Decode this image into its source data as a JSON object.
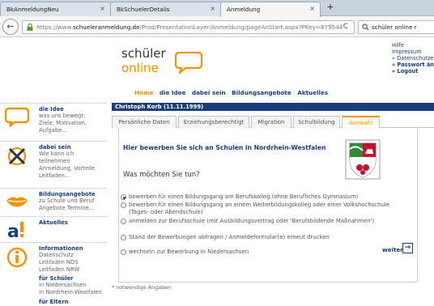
{
  "browser": {
    "tabs": [
      {
        "title": "BkAnmeldungNeu",
        "active": false
      },
      {
        "title": "BkSchuelerDetails",
        "active": false
      },
      {
        "title": "Anmeldung",
        "active": true
      }
    ],
    "close_glyph": "×",
    "new_tab_glyph": "+",
    "url_prefix": "https://www.",
    "url_domain": "schueleranmeldung.de",
    "url_path": "/Prod/PresentationLayer/Anmeldung/pageAnStart.aspx?PKey=875544",
    "search_text": "schüler online r",
    "back_glyph": "←",
    "dropdown_glyph": "▽",
    "reload_glyph": "C",
    "search_glyph": "🔍"
  },
  "header": {
    "logo_line1": "schüler",
    "logo_line2": "online",
    "top_links": [
      {
        "text": "Hilfe",
        "bold": false
      },
      {
        "text": "Impressum",
        "bold": false
      },
      {
        "text": "» Datenschutzerklä",
        "bold": false
      },
      {
        "text": "« Passwort änder",
        "bold": true
      },
      {
        "text": "« Logout",
        "bold": true
      }
    ],
    "nav": [
      "Home",
      "die Idee",
      "dabei sein",
      "Bildungsangebote",
      "Aktuelles"
    ]
  },
  "sidebar": {
    "items": [
      {
        "title": "die Idee",
        "desc": [
          "was uns bewegt:",
          "Ziele, Motivation,",
          "Aufgabe..."
        ],
        "icon": "speech-bubble-icon"
      },
      {
        "title": "dabei sein",
        "desc": [
          "Wie kann ich",
          "teilnehmen",
          "Anmeldung, Vorteile",
          "Leitfaden..."
        ],
        "icon": "cross-circle-icon"
      },
      {
        "title": "Bildungsangebote",
        "desc": [
          "zu Schule und Beruf",
          "Angebote Termine..."
        ],
        "icon": "lips-icon"
      },
      {
        "title": "Aktuelles",
        "desc": [],
        "icon": "a-exclaim-icon"
      },
      {
        "title": "Informationen",
        "desc": [
          "Datenschutz",
          "Leitfaden NDS",
          "Leitfaden NRW"
        ],
        "icon": "info-icon"
      }
    ],
    "extra": [
      {
        "title": "für Schüler",
        "desc": [
          "in Niedersachsen",
          "in Nordrhein-Westfalen"
        ]
      },
      {
        "title": "für Eltern",
        "desc": []
      }
    ],
    "colors": {
      "orange": "#f39200",
      "navy": "#1a3d7c"
    }
  },
  "form": {
    "student_name": "Christoph Korb (11.11.1999)",
    "tabs": [
      "Persönliche Daten",
      "Erziehungsberechtigt",
      "Migration",
      "Schulbildung",
      "Auswahl"
    ],
    "active_tab": "Auswahl",
    "heading": "Hier bewerben Sie sich an Schulen in Nordrhein-Westfalen",
    "question": "Was möchten Sie tun?",
    "options": [
      {
        "lines": [
          "bewerben für einen Bildungsgang am Berufskolleg (ohne Berufliches Gymnasium)"
        ],
        "selected": true
      },
      {
        "lines": [
          "bewerben für einen Bildungsgang an einem Weiterbildungskolleg oder einer Volkshochschule",
          "(Tages- oder Abendschule)"
        ],
        "selected": false
      },
      {
        "lines": [
          "anmelden zur Berufsschule (mit Ausbildungsvertrag oder 'Berufsbildende Maßnahmen')"
        ],
        "selected": false
      },
      {
        "lines": [
          "Stand der Bewerbungen abfragen / Anmeldeformular(e) erneut drucken"
        ],
        "selected": false
      },
      {
        "lines": [
          "wechseln zur Bewerbung in Niedersachsen"
        ],
        "selected": false
      }
    ],
    "next_label": "weiter",
    "next_glyph": "→",
    "footnote": "* notwendige Angaben"
  }
}
